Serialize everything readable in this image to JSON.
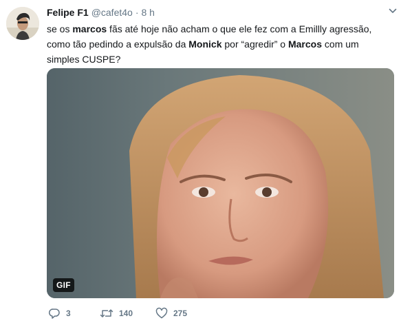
{
  "tweet": {
    "author_name": "Felipe F1",
    "author_handle": "@cafet4o",
    "separator": "·",
    "time": "8 h",
    "text_parts": [
      {
        "t": "se os ",
        "b": false
      },
      {
        "t": "marcos",
        "b": true
      },
      {
        "t": " fãs até hoje não acham o que ele fez com a Emillly agressão, como tão pedindo a expulsão da ",
        "b": false
      },
      {
        "t": "Monick",
        "b": true
      },
      {
        "t": " por “agredir” o ",
        "b": false
      },
      {
        "t": "Marcos",
        "b": true
      },
      {
        "t": " com um simples CUSPE?",
        "b": false
      }
    ],
    "media": {
      "badge": "GIF"
    },
    "actions": {
      "reply_count": "3",
      "retweet_count": "140",
      "like_count": "275"
    }
  },
  "colors": {
    "text": "#14171a",
    "secondary": "#657786",
    "background": "#ffffff"
  },
  "icons": [
    "avatar",
    "chevron-down-icon",
    "reply-icon",
    "retweet-icon",
    "like-icon"
  ]
}
